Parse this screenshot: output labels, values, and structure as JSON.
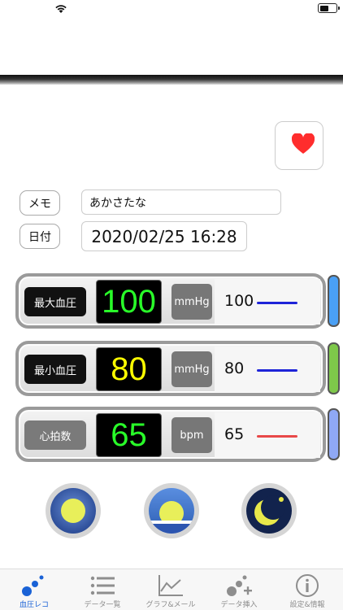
{
  "status_bar": {
    "icons": [
      "wifi-icon",
      "battery-icon"
    ],
    "battery_level": 0.5
  },
  "favorite": {
    "icon": "heart-icon",
    "color": "#ff2d2d"
  },
  "form": {
    "memo_label": "メモ",
    "memo_value": "あかさたな",
    "date_label": "日付",
    "date_value": "2020/02/25 16:28"
  },
  "measurements": [
    {
      "label": "最大血圧",
      "value": "100",
      "unit": "mmHg",
      "value_text": "100",
      "display_color": "#29ff29",
      "label_color": "#111111",
      "line_color": "#1e24d8",
      "pill_color": "#4aa0f5"
    },
    {
      "label": "最小血圧",
      "value": "80",
      "unit": "mmHg",
      "value_text": "80",
      "display_color": "#ffff00",
      "label_color": "#111111",
      "line_color": "#1e24d8",
      "pill_color": "#7ec84a"
    },
    {
      "label": "心拍数",
      "value": "65",
      "unit": "bpm",
      "value_text": "65",
      "display_color": "#29ff29",
      "label_color": "#7a7a7a",
      "line_color": "#e84848",
      "pill_color": "#8fa8f5"
    }
  ],
  "time_of_day": [
    {
      "name": "morning",
      "icon": "sun-icon"
    },
    {
      "name": "evening",
      "icon": "sunset-icon"
    },
    {
      "name": "night",
      "icon": "moon-icon"
    }
  ],
  "tabs": [
    {
      "label": "血圧レコ",
      "icon": "record-dots-icon",
      "active": true
    },
    {
      "label": "データ一覧",
      "icon": "list-icon",
      "active": false
    },
    {
      "label": "グラフ&メール",
      "icon": "graph-icon",
      "active": false
    },
    {
      "label": "データ挿入",
      "icon": "insert-data-icon",
      "active": false
    },
    {
      "label": "設定&情報",
      "icon": "info-icon",
      "active": false
    }
  ],
  "colors": {
    "accent": "#1a62d6",
    "inactive": "#8e8e8e"
  }
}
